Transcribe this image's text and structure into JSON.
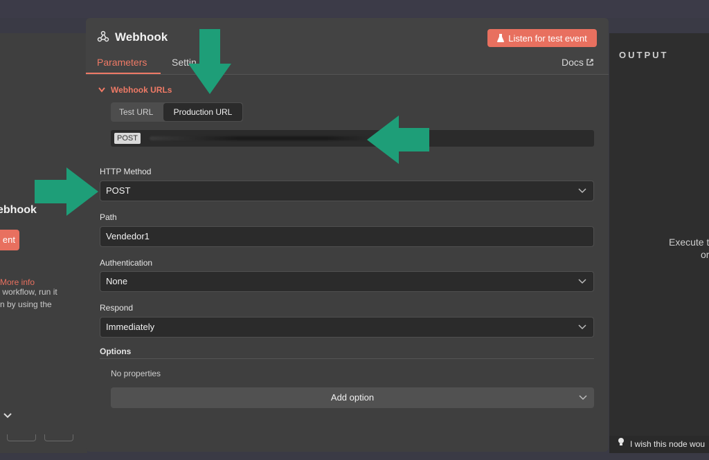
{
  "left_panel": {
    "title": "ebhook",
    "button_label": "ent",
    "desc_line1": "r workflow, run it",
    "desc_line2": "n by using the",
    "more_info": "More info"
  },
  "node": {
    "title": "Webhook",
    "listen_label": "Listen for test event",
    "tabs": {
      "parameters": "Parameters",
      "settings": "Settin"
    },
    "docs": "Docs"
  },
  "webhook_urls": {
    "section_label": "Webhook URLs",
    "test_url": "Test URL",
    "production_url": "Production URL",
    "method_badge": "POST"
  },
  "fields": {
    "http_method": {
      "label": "HTTP Method",
      "value": "POST"
    },
    "path": {
      "label": "Path",
      "value": "Vendedor1"
    },
    "authentication": {
      "label": "Authentication",
      "value": "None"
    },
    "respond": {
      "label": "Respond",
      "value": "Immediately"
    }
  },
  "options": {
    "label": "Options",
    "empty_text": "No properties",
    "add_option": "Add option"
  },
  "output": {
    "title": "OUTPUT",
    "execute_text": "Execute t",
    "or_text": "or",
    "wish_text": "I wish this node wou"
  },
  "colors": {
    "accent": "#ef7a66",
    "button": "#e8705f",
    "annotation_arrow": "#1e9e78"
  }
}
